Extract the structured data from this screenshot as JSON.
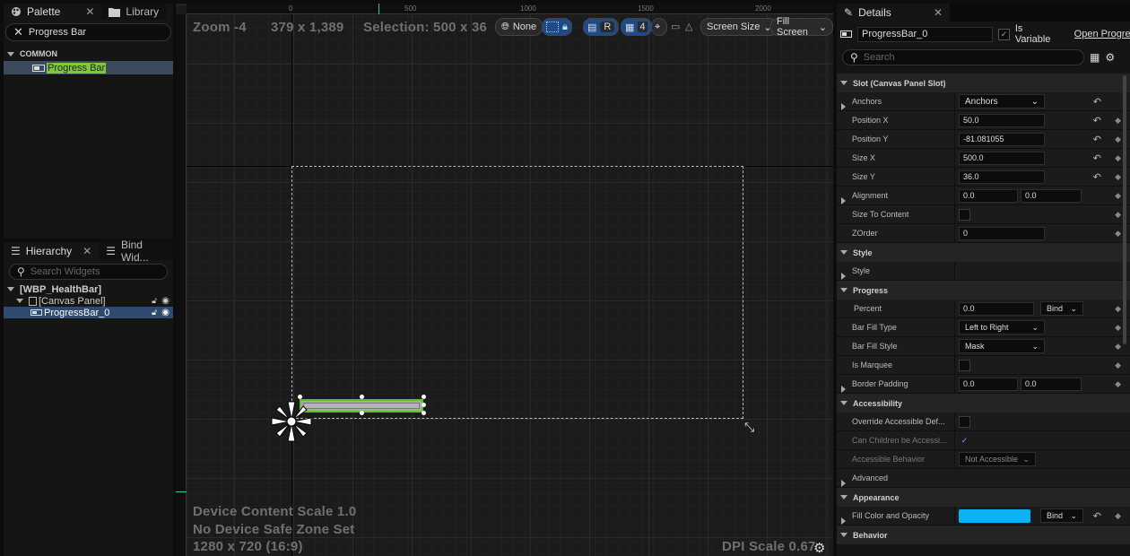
{
  "palette": {
    "tab_palette": "Palette",
    "tab_library": "Library",
    "search_value": "Progress Bar",
    "category": "COMMON",
    "item": "Progress Bar"
  },
  "hierarchy": {
    "tab_hierarchy": "Hierarchy",
    "tab_bind": "Bind Wid...",
    "search_placeholder": "Search Widgets",
    "root": "[WBP_HealthBar]",
    "canvas": "[Canvas Panel]",
    "child": "ProgressBar_0"
  },
  "viewport": {
    "zoom": "Zoom -4",
    "coords": "379 x 1,389",
    "selection": "Selection: 500 x 36",
    "none_label": "None",
    "r_label": "R",
    "grid_label": "4",
    "screen_size": "Screen Size",
    "fill_screen": "Fill Screen",
    "ruler_0": "0",
    "ruler_500": "500",
    "ruler_1000": "1000",
    "ruler_1500": "1500",
    "ruler_2000": "2000",
    "device_scale": "Device Content Scale 1.0",
    "safe_zone": "No Device Safe Zone Set",
    "resolution": "1280 x 720 (16:9)",
    "dpi": "DPI Scale 0.67"
  },
  "details": {
    "tab": "Details",
    "name": "ProgressBar_0",
    "is_variable": "Is Variable",
    "open": "Open Progres",
    "search_placeholder": "Search",
    "slot": "Slot (Canvas Panel Slot)",
    "anchors_label": "Anchors",
    "anchors_value": "Anchors",
    "posx_label": "Position X",
    "posx": "50.0",
    "posy_label": "Position Y",
    "posy": "-81.081055",
    "sizex_label": "Size X",
    "sizex": "500.0",
    "sizey_label": "Size Y",
    "sizey": "36.0",
    "align_label": "Alignment",
    "align_x": "0.0",
    "align_y": "0.0",
    "size_to_content": "Size To Content",
    "zorder_label": "ZOrder",
    "zorder": "0",
    "style_section": "Style",
    "style_row": "Style",
    "progress_section": "Progress",
    "percent_label": "Percent",
    "percent": "0.0",
    "bind": "Bind",
    "fill_type_label": "Bar Fill Type",
    "fill_type": "Left to Right",
    "fill_style_label": "Bar Fill Style",
    "fill_style": "Mask",
    "marquee_label": "Is Marquee",
    "border_label": "Border Padding",
    "border_x": "0.0",
    "border_y": "0.0",
    "access_section": "Accessibility",
    "override_label": "Override Accessible Def...",
    "children_label": "Can Children be Accessi...",
    "behavior_label": "Accessible Behavior",
    "behavior_value": "Not Accessible",
    "advanced": "Advanced",
    "appearance_section": "Appearance",
    "fill_color_label": "Fill Color and Opacity",
    "bind2": "Bind",
    "behavior_section": "Behavior",
    "fill_color_hex": "#0bb3f5"
  }
}
